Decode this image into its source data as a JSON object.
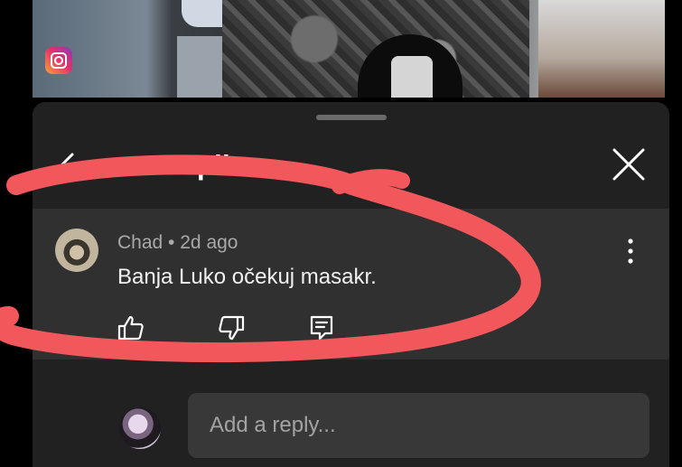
{
  "header": {
    "title": "Replies"
  },
  "comment": {
    "author": "Chad",
    "separator": "•",
    "time": "2d ago",
    "text": "Banja Luko očekuj masakr."
  },
  "composer": {
    "placeholder": "Add a reply..."
  },
  "icons": {
    "back": "back-arrow-icon",
    "close": "close-icon",
    "more": "more-vertical-icon",
    "like": "thumb-up-icon",
    "dislike": "thumb-down-icon",
    "reply": "comment-reply-icon",
    "overlay": "instagram-icon"
  },
  "colors": {
    "sheet": "#212121",
    "comment_bg": "#303030",
    "input_bg": "#383838",
    "annotation": "#f2575c",
    "meta_text": "#a9a9a9"
  }
}
